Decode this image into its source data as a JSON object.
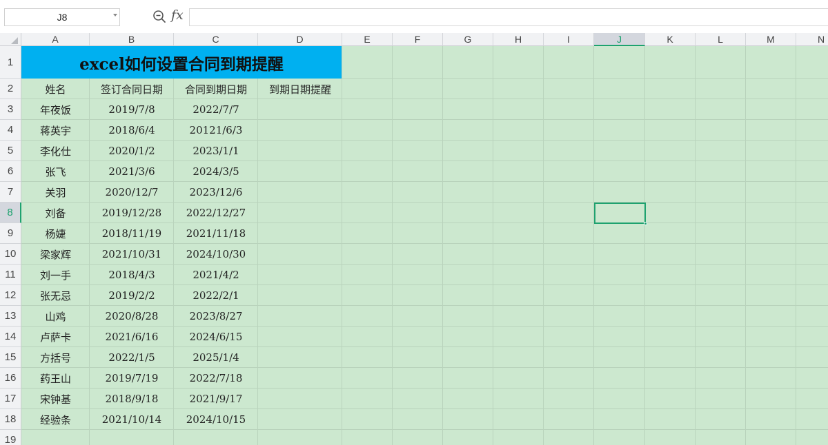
{
  "formula_bar": {
    "name_box": "J8",
    "fx_label": "fx",
    "formula": ""
  },
  "columns": [
    "A",
    "B",
    "C",
    "D",
    "E",
    "F",
    "G",
    "H",
    "I",
    "J",
    "K",
    "L",
    "M",
    "N"
  ],
  "active_column": "J",
  "rows": [
    "1",
    "2",
    "3",
    "4",
    "5",
    "6",
    "7",
    "8",
    "9",
    "10",
    "11",
    "12",
    "13",
    "14",
    "15",
    "16",
    "17",
    "18",
    "19"
  ],
  "active_row": "8",
  "title": "excel如何设置合同到期提醒",
  "headers": [
    "姓名",
    "签订合同日期",
    "合同到期日期",
    "到期日期提醒"
  ],
  "records": [
    [
      "年夜饭",
      "2019/7/8",
      "2022/7/7",
      ""
    ],
    [
      "蒋英宇",
      "2018/6/4",
      "20121/6/3",
      ""
    ],
    [
      "李化仕",
      "2020/1/2",
      "2023/1/1",
      ""
    ],
    [
      "张飞",
      "2021/3/6",
      "2024/3/5",
      ""
    ],
    [
      "关羽",
      "2020/12/7",
      "2023/12/6",
      ""
    ],
    [
      "刘备",
      "2019/12/28",
      "2022/12/27",
      ""
    ],
    [
      "杨婕",
      "2018/11/19",
      "2021/11/18",
      ""
    ],
    [
      "梁家辉",
      "2021/10/31",
      "2024/10/30",
      ""
    ],
    [
      "刘一手",
      "2018/4/3",
      "2021/4/2",
      ""
    ],
    [
      "张无忌",
      "2019/2/2",
      "2022/2/1",
      ""
    ],
    [
      "山鸡",
      "2020/8/28",
      "2023/8/27",
      ""
    ],
    [
      "卢萨卡",
      "2021/6/16",
      "2024/6/15",
      ""
    ],
    [
      "方括号",
      "2022/1/5",
      "2025/1/4",
      ""
    ],
    [
      "药王山",
      "2019/7/19",
      "2022/7/18",
      ""
    ],
    [
      "宋钟基",
      "2018/9/18",
      "2021/9/17",
      ""
    ],
    [
      "经验条",
      "2021/10/14",
      "2024/10/15",
      ""
    ]
  ],
  "colors": {
    "grid_background": "#cce8cf",
    "title_fill": "#00b0f0",
    "selection": "#1ea26f",
    "header_background": "#f1f2f4"
  },
  "icons": {
    "zoom": "magnifier-zoom-icon",
    "fx": "function-icon",
    "dropdown": "chevron-down-icon"
  }
}
